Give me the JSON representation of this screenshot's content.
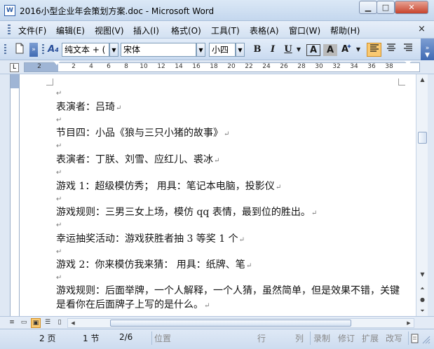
{
  "window": {
    "icon_glyph": "W",
    "title": "2016小型企业年会策划方案.doc - Microsoft Word",
    "min_glyph": "▁",
    "max_glyph": "□",
    "close_glyph": "✕"
  },
  "menu": {
    "items": [
      "文件(F)",
      "编辑(E)",
      "视图(V)",
      "插入(I)",
      "格式(O)",
      "工具(T)",
      "表格(A)",
      "窗口(W)",
      "帮助(H)"
    ],
    "close_glyph": "×"
  },
  "toolbar": {
    "style_value": "纯文本 + (",
    "font_value": "宋体",
    "size_value": "小四",
    "bold": "B",
    "italic": "I",
    "underline": "U",
    "char_border": "A",
    "char_shading": "A",
    "highlight_color": "#f7d13a",
    "font_color": "#d82a20"
  },
  "ruler": {
    "numbers": [
      "2",
      "2",
      "4",
      "6",
      "8",
      "10",
      "12",
      "14",
      "16",
      "18",
      "20",
      "22",
      "24",
      "26",
      "28",
      "30",
      "32",
      "34",
      "36",
      "38"
    ]
  },
  "document": {
    "paragraph_mark": "↵",
    "paragraphs": [
      "",
      "表演者：吕琦",
      "",
      "节目四：小品《狼与三只小猪的故事》",
      "",
      "表演者：丁朕、刘雪、应红儿、裘冰",
      "",
      "游戏 1：超级模仿秀；  用具：笔记本电脑，投影仪",
      "",
      "游戏规则：三男三女上场，模仿 qq 表情，最到位的胜出。",
      "",
      "幸运抽奖活动：游戏获胜者抽 3 等奖 1 个",
      "",
      "游戏 2：你来模仿我来猜：  用具：纸牌、笔",
      "",
      "游戏规则：后面举牌，一个人解释，一个人猜，虽然简单，但是效果不错，关键",
      "是看你在后面牌子上写的是什么。"
    ]
  },
  "status": {
    "page": "2 页",
    "section": "1 节",
    "page_of": "2/6",
    "position": "位置",
    "line": "行",
    "column": "列",
    "record": "录制",
    "revise": "修订",
    "extend": "扩展",
    "overwrite": "改写"
  }
}
